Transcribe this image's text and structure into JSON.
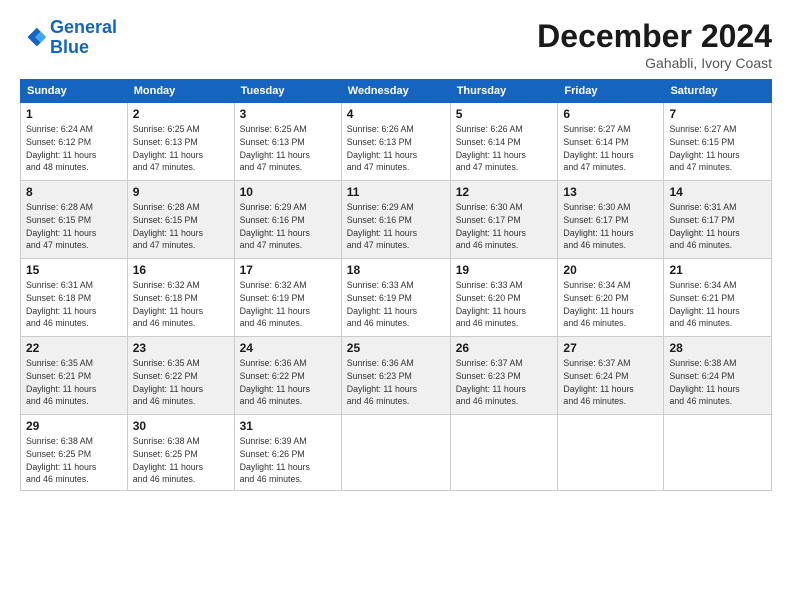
{
  "logo": {
    "line1": "General",
    "line2": "Blue"
  },
  "title": "December 2024",
  "location": "Gahabli, Ivory Coast",
  "weekdays": [
    "Sunday",
    "Monday",
    "Tuesday",
    "Wednesday",
    "Thursday",
    "Friday",
    "Saturday"
  ],
  "weeks": [
    [
      {
        "day": "1",
        "sunrise": "6:24 AM",
        "sunset": "6:12 PM",
        "daylight": "11 hours and 48 minutes."
      },
      {
        "day": "2",
        "sunrise": "6:25 AM",
        "sunset": "6:13 PM",
        "daylight": "11 hours and 47 minutes."
      },
      {
        "day": "3",
        "sunrise": "6:25 AM",
        "sunset": "6:13 PM",
        "daylight": "11 hours and 47 minutes."
      },
      {
        "day": "4",
        "sunrise": "6:26 AM",
        "sunset": "6:13 PM",
        "daylight": "11 hours and 47 minutes."
      },
      {
        "day": "5",
        "sunrise": "6:26 AM",
        "sunset": "6:14 PM",
        "daylight": "11 hours and 47 minutes."
      },
      {
        "day": "6",
        "sunrise": "6:27 AM",
        "sunset": "6:14 PM",
        "daylight": "11 hours and 47 minutes."
      },
      {
        "day": "7",
        "sunrise": "6:27 AM",
        "sunset": "6:15 PM",
        "daylight": "11 hours and 47 minutes."
      }
    ],
    [
      {
        "day": "8",
        "sunrise": "6:28 AM",
        "sunset": "6:15 PM",
        "daylight": "11 hours and 47 minutes."
      },
      {
        "day": "9",
        "sunrise": "6:28 AM",
        "sunset": "6:15 PM",
        "daylight": "11 hours and 47 minutes."
      },
      {
        "day": "10",
        "sunrise": "6:29 AM",
        "sunset": "6:16 PM",
        "daylight": "11 hours and 47 minutes."
      },
      {
        "day": "11",
        "sunrise": "6:29 AM",
        "sunset": "6:16 PM",
        "daylight": "11 hours and 47 minutes."
      },
      {
        "day": "12",
        "sunrise": "6:30 AM",
        "sunset": "6:17 PM",
        "daylight": "11 hours and 46 minutes."
      },
      {
        "day": "13",
        "sunrise": "6:30 AM",
        "sunset": "6:17 PM",
        "daylight": "11 hours and 46 minutes."
      },
      {
        "day": "14",
        "sunrise": "6:31 AM",
        "sunset": "6:17 PM",
        "daylight": "11 hours and 46 minutes."
      }
    ],
    [
      {
        "day": "15",
        "sunrise": "6:31 AM",
        "sunset": "6:18 PM",
        "daylight": "11 hours and 46 minutes."
      },
      {
        "day": "16",
        "sunrise": "6:32 AM",
        "sunset": "6:18 PM",
        "daylight": "11 hours and 46 minutes."
      },
      {
        "day": "17",
        "sunrise": "6:32 AM",
        "sunset": "6:19 PM",
        "daylight": "11 hours and 46 minutes."
      },
      {
        "day": "18",
        "sunrise": "6:33 AM",
        "sunset": "6:19 PM",
        "daylight": "11 hours and 46 minutes."
      },
      {
        "day": "19",
        "sunrise": "6:33 AM",
        "sunset": "6:20 PM",
        "daylight": "11 hours and 46 minutes."
      },
      {
        "day": "20",
        "sunrise": "6:34 AM",
        "sunset": "6:20 PM",
        "daylight": "11 hours and 46 minutes."
      },
      {
        "day": "21",
        "sunrise": "6:34 AM",
        "sunset": "6:21 PM",
        "daylight": "11 hours and 46 minutes."
      }
    ],
    [
      {
        "day": "22",
        "sunrise": "6:35 AM",
        "sunset": "6:21 PM",
        "daylight": "11 hours and 46 minutes."
      },
      {
        "day": "23",
        "sunrise": "6:35 AM",
        "sunset": "6:22 PM",
        "daylight": "11 hours and 46 minutes."
      },
      {
        "day": "24",
        "sunrise": "6:36 AM",
        "sunset": "6:22 PM",
        "daylight": "11 hours and 46 minutes."
      },
      {
        "day": "25",
        "sunrise": "6:36 AM",
        "sunset": "6:23 PM",
        "daylight": "11 hours and 46 minutes."
      },
      {
        "day": "26",
        "sunrise": "6:37 AM",
        "sunset": "6:23 PM",
        "daylight": "11 hours and 46 minutes."
      },
      {
        "day": "27",
        "sunrise": "6:37 AM",
        "sunset": "6:24 PM",
        "daylight": "11 hours and 46 minutes."
      },
      {
        "day": "28",
        "sunrise": "6:38 AM",
        "sunset": "6:24 PM",
        "daylight": "11 hours and 46 minutes."
      }
    ],
    [
      {
        "day": "29",
        "sunrise": "6:38 AM",
        "sunset": "6:25 PM",
        "daylight": "11 hours and 46 minutes."
      },
      {
        "day": "30",
        "sunrise": "6:38 AM",
        "sunset": "6:25 PM",
        "daylight": "11 hours and 46 minutes."
      },
      {
        "day": "31",
        "sunrise": "6:39 AM",
        "sunset": "6:26 PM",
        "daylight": "11 hours and 46 minutes."
      },
      null,
      null,
      null,
      null
    ]
  ]
}
